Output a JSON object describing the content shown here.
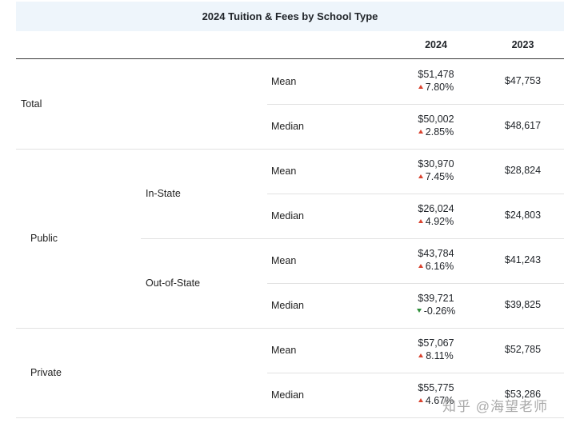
{
  "title": "2024 Tuition & Fees by School Type",
  "headers": {
    "y2024": "2024",
    "y2023": "2023"
  },
  "groups": {
    "total": "Total",
    "public": "Public",
    "private": "Private"
  },
  "subgroups": {
    "in_state": "In-State",
    "out_of_state": "Out-of-State"
  },
  "rows": [
    {
      "stat": "Mean",
      "v2024": "$51,478",
      "change": "7.80%",
      "direction": "up",
      "v2023": "$47,753"
    },
    {
      "stat": "Median",
      "v2024": "$50,002",
      "change": "2.85%",
      "direction": "up",
      "v2023": "$48,617"
    },
    {
      "stat": "Mean",
      "v2024": "$30,970",
      "change": "7.45%",
      "direction": "up",
      "v2023": "$28,824"
    },
    {
      "stat": "Median",
      "v2024": "$26,024",
      "change": "4.92%",
      "direction": "up",
      "v2023": "$24,803"
    },
    {
      "stat": "Mean",
      "v2024": "$43,784",
      "change": "6.16%",
      "direction": "up",
      "v2023": "$41,243"
    },
    {
      "stat": "Median",
      "v2024": "$39,721",
      "change": "-0.26%",
      "direction": "down",
      "v2023": "$39,825"
    },
    {
      "stat": "Mean",
      "v2024": "$57,067",
      "change": "8.11%",
      "direction": "up",
      "v2023": "$52,785"
    },
    {
      "stat": "Median",
      "v2024": "$55,775",
      "change": "4.67%",
      "direction": "up",
      "v2023": "$53,286"
    }
  ],
  "colors": {
    "up": "#d9432f",
    "down": "#2f8f3a",
    "title_bg": "#eef5fb"
  },
  "watermark": "知乎 @海望老师"
}
